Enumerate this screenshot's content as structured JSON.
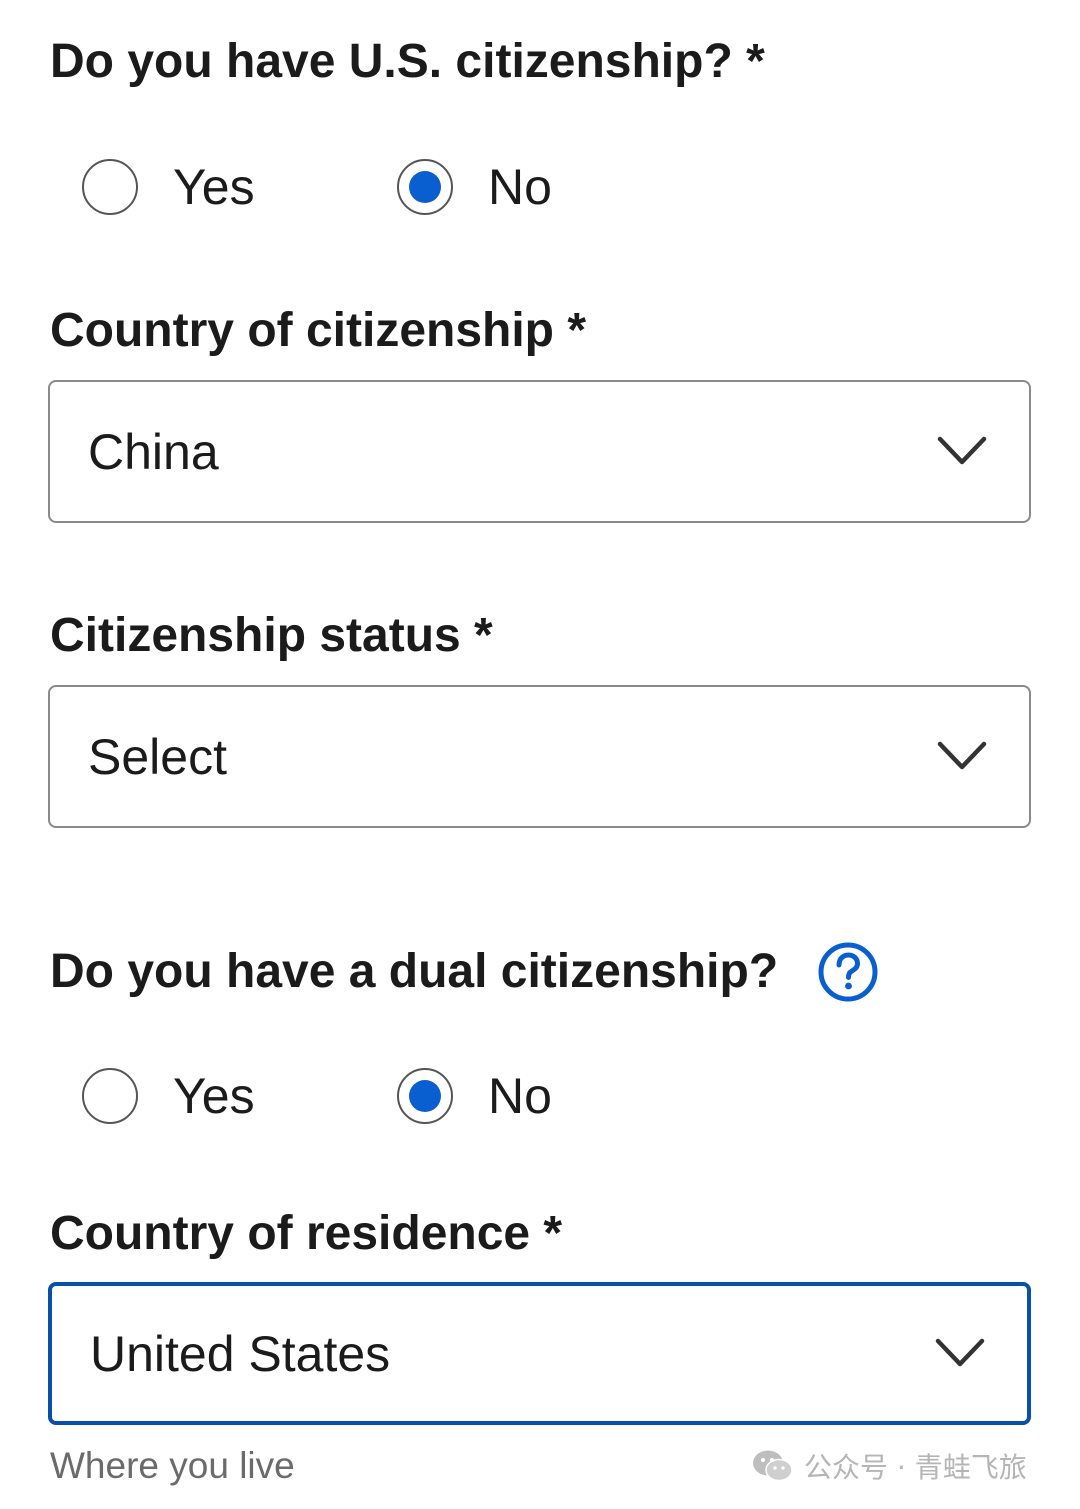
{
  "citizenship_question": {
    "label": "Do you have U.S. citizenship? *",
    "options": [
      {
        "label": "Yes",
        "selected": false
      },
      {
        "label": "No",
        "selected": true
      }
    ]
  },
  "country_of_citizenship": {
    "label": "Country of citizenship *",
    "value": "China"
  },
  "citizenship_status": {
    "label": "Citizenship status *",
    "value": "Select"
  },
  "dual_citizenship_question": {
    "label": "Do you have a dual citizenship?",
    "help_icon": "question-circle-icon",
    "options": [
      {
        "label": "Yes",
        "selected": false
      },
      {
        "label": "No",
        "selected": true
      }
    ]
  },
  "country_of_residence": {
    "label": "Country of residence *",
    "value": "United States",
    "hint": "Where you live"
  },
  "watermark": {
    "icon": "wechat-icon",
    "text": "公众号 · 青蛙飞旅"
  },
  "colors": {
    "accent_blue": "#0a5fd0",
    "focus_border": "#0a4fa8",
    "text": "#1b1b1b",
    "hint": "#6b6b6b",
    "border": "#8a8a8a"
  }
}
